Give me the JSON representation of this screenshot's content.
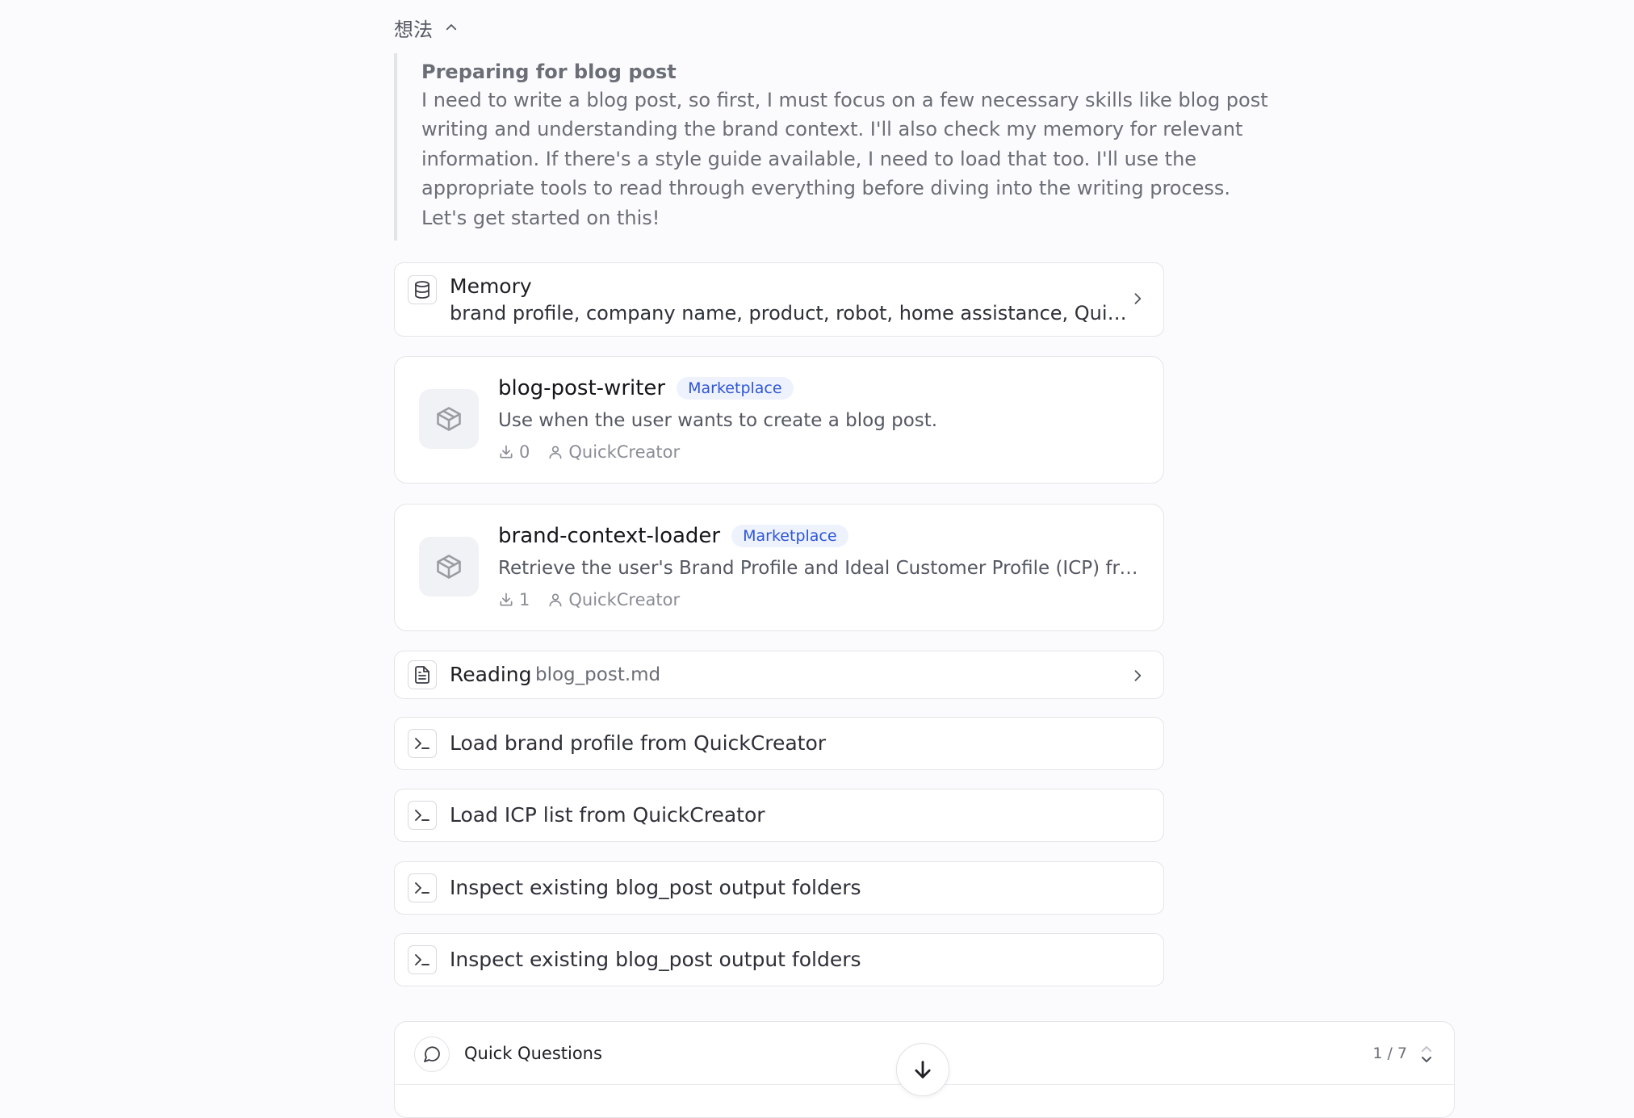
{
  "thoughts": {
    "toggle_label": "想法",
    "title": "Preparing for blog post",
    "body": "I need to write a blog post, so first, I must focus on a few necessary skills like blog post writing and understanding the brand context. I'll also check my memory for relevant information. If there's a style guide available, I need to load that too. I'll use the appropriate tools to read through everything before diving into the writing process. Let's get started on this!"
  },
  "memory": {
    "title": "Memory",
    "summary": "brand profile, company name, product, robot, home assistance, QuickCreator, brand context, ICP"
  },
  "skills": [
    {
      "name": "blog-post-writer",
      "badge": "Marketplace",
      "description": "Use when the user wants to create a blog post.",
      "downloads": "0",
      "author": "QuickCreator"
    },
    {
      "name": "brand-context-loader",
      "badge": "Marketplace",
      "description": "Retrieve the user's Brand Profile and Ideal Customer Profile (ICP) from the QuickCreator platform.",
      "downloads": "1",
      "author": "QuickCreator"
    }
  ],
  "reading": {
    "label": "Reading",
    "file": "blog_post.md"
  },
  "steps": [
    {
      "label": "Load brand profile from QuickCreator"
    },
    {
      "label": "Load ICP list from QuickCreator"
    },
    {
      "label": "Inspect existing blog_post output folders"
    },
    {
      "label": "Inspect existing blog_post output folders"
    }
  ],
  "quick_questions": {
    "title": "Quick Questions",
    "counter": "1 / 7"
  },
  "icons": {
    "toggle": "chevron-up-icon",
    "memory": "database-icon",
    "skill": "package-icon",
    "reading": "file-text-icon",
    "step": "terminal-icon",
    "quick": "message-circle-icon",
    "scroll": "arrow-down-icon"
  }
}
